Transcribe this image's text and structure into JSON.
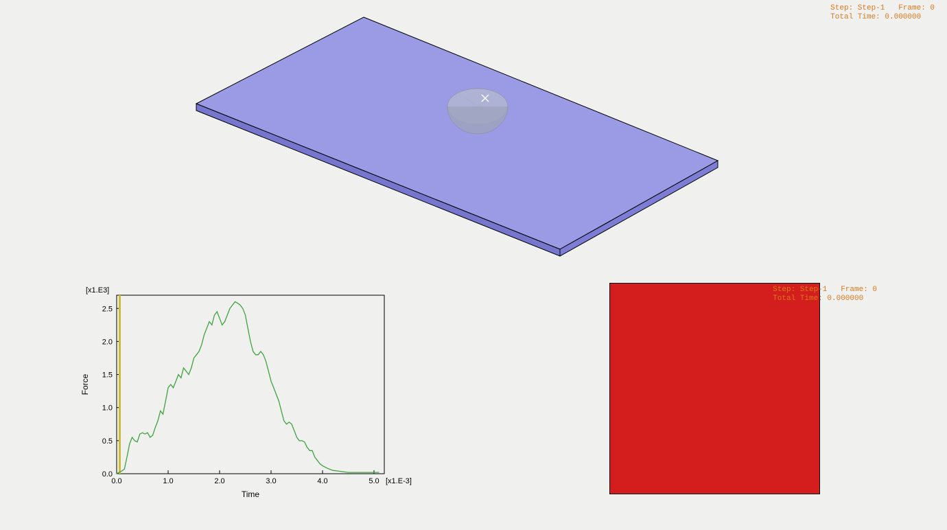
{
  "status_top": {
    "line1": "Step: Step-1   Frame: 0",
    "line2": "Total Time: 0.000000"
  },
  "status_bottom": {
    "line1": "Step: Step-1   Frame: 0",
    "line2": "Total Time: 0.000000"
  },
  "chart_data": {
    "type": "line",
    "xlabel": "Time",
    "ylabel": "Force",
    "x_multiplier": "[x1.E-3]",
    "y_multiplier": "[x1.E3]",
    "xlim": [
      0.0,
      5.2
    ],
    "ylim": [
      0.0,
      2.7
    ],
    "xticks": [
      0.0,
      1.0,
      2.0,
      3.0,
      4.0,
      5.0
    ],
    "yticks": [
      0.0,
      0.5,
      1.0,
      1.5,
      2.0,
      2.5
    ],
    "marker_x": 0.06,
    "series": [
      {
        "name": "Force",
        "color": "#3fa23f",
        "x": [
          0.0,
          0.05,
          0.1,
          0.15,
          0.2,
          0.25,
          0.3,
          0.35,
          0.4,
          0.45,
          0.5,
          0.55,
          0.6,
          0.65,
          0.7,
          0.75,
          0.8,
          0.85,
          0.9,
          0.95,
          1.0,
          1.05,
          1.1,
          1.15,
          1.2,
          1.25,
          1.3,
          1.35,
          1.4,
          1.45,
          1.5,
          1.55,
          1.6,
          1.65,
          1.7,
          1.75,
          1.8,
          1.85,
          1.9,
          1.95,
          2.0,
          2.05,
          2.1,
          2.15,
          2.2,
          2.25,
          2.3,
          2.35,
          2.4,
          2.45,
          2.5,
          2.55,
          2.6,
          2.65,
          2.7,
          2.75,
          2.8,
          2.85,
          2.9,
          2.95,
          3.0,
          3.05,
          3.1,
          3.15,
          3.2,
          3.25,
          3.3,
          3.35,
          3.4,
          3.45,
          3.5,
          3.55,
          3.6,
          3.65,
          3.7,
          3.75,
          3.8,
          3.85,
          3.9,
          3.95,
          4.0,
          4.1,
          4.2,
          4.3,
          4.4,
          4.5,
          4.6,
          4.7,
          4.8,
          4.9,
          5.0,
          5.1
        ],
        "y": [
          0.0,
          0.02,
          0.04,
          0.07,
          0.25,
          0.45,
          0.55,
          0.5,
          0.48,
          0.6,
          0.62,
          0.6,
          0.62,
          0.55,
          0.58,
          0.7,
          0.8,
          0.95,
          0.9,
          1.1,
          1.3,
          1.35,
          1.3,
          1.4,
          1.5,
          1.45,
          1.6,
          1.55,
          1.5,
          1.6,
          1.75,
          1.8,
          1.85,
          1.95,
          2.1,
          2.2,
          2.3,
          2.25,
          2.4,
          2.45,
          2.35,
          2.25,
          2.3,
          2.4,
          2.5,
          2.55,
          2.6,
          2.58,
          2.55,
          2.5,
          2.4,
          2.2,
          2.0,
          1.85,
          1.8,
          1.8,
          1.85,
          1.8,
          1.7,
          1.55,
          1.4,
          1.3,
          1.2,
          1.1,
          0.95,
          0.8,
          0.75,
          0.78,
          0.75,
          0.65,
          0.55,
          0.5,
          0.5,
          0.48,
          0.4,
          0.35,
          0.35,
          0.25,
          0.2,
          0.15,
          0.12,
          0.08,
          0.05,
          0.04,
          0.03,
          0.02,
          0.02,
          0.02,
          0.02,
          0.02,
          0.02,
          0.02
        ]
      }
    ]
  },
  "colors": {
    "plate": "#7a7ae0",
    "ball": "#b4b9cf",
    "chart_frame": "#000",
    "marker": "#ccbb33"
  }
}
